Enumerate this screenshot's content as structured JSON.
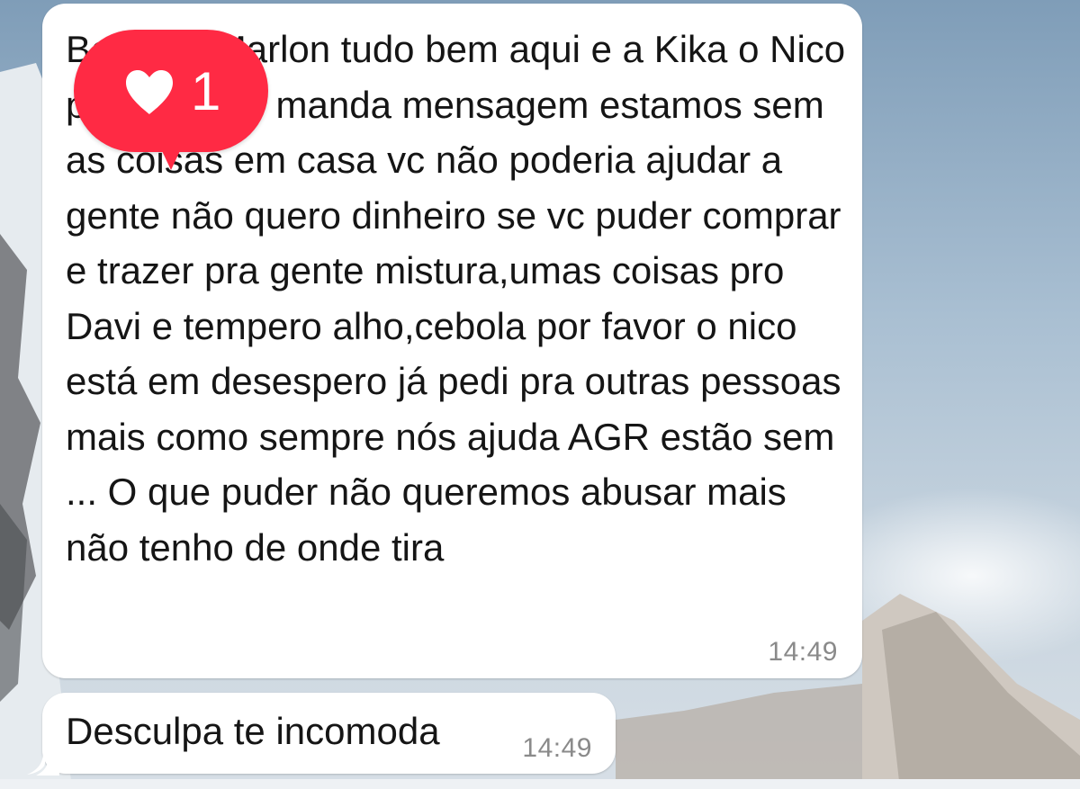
{
  "conversation": {
    "messages": [
      {
        "text": "Bom dia Marlon tudo bem aqui e a Kika o Nico pediu pra te manda mensagem estamos sem as coisas em casa vc não poderia ajudar a gente não quero dinheiro se vc puder comprar e trazer pra gente mistura,umas coisas pro Davi e tempero alho,cebola por favor o nico está em desespero já pedi pra outras pessoas mais como sempre nós ajuda AGR estão sem ... O que puder não queremos abusar mais não tenho de onde tira",
        "time": "14:49",
        "reaction": {
          "icon": "heart-icon",
          "count": "1",
          "color": "#ff2a44"
        }
      },
      {
        "text": "Desculpa te incomoda",
        "time": "14:49"
      }
    ]
  },
  "colors": {
    "bubble": "#ffffff",
    "text": "#151515",
    "timestamp": "#8a8a8a",
    "reaction": "#ff2a44"
  }
}
